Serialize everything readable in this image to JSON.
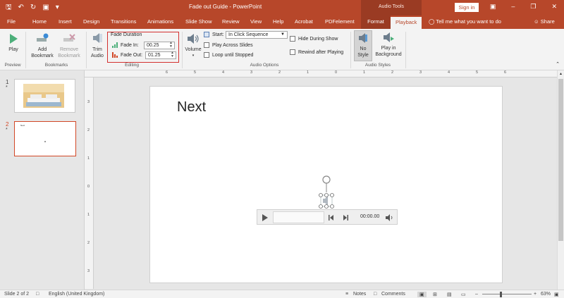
{
  "titlebar": {
    "doc_title": "Fade out Guide  -  PowerPoint",
    "context_group": "Audio Tools",
    "sign_in": "Sign in",
    "qat_icons": [
      "save-icon",
      "undo-icon",
      "redo-icon",
      "presentation-icon",
      "customize-icon"
    ],
    "window_controls": [
      "ribbon-options-icon",
      "minimize-icon",
      "restore-icon",
      "close-icon"
    ]
  },
  "tabs": [
    "File",
    "Home",
    "Insert",
    "Design",
    "Transitions",
    "Animations",
    "Slide Show",
    "Review",
    "View",
    "Help",
    "Acrobat",
    "PDFelement",
    "Format",
    "Playback"
  ],
  "tell_me": "Tell me what you want to do",
  "share": "Share",
  "ribbon": {
    "preview": {
      "label": "Preview",
      "play": "Play"
    },
    "bookmarks": {
      "label": "Bookmarks",
      "add_line1": "Add",
      "add_line2": "Bookmark",
      "remove_line1": "Remove",
      "remove_line2": "Bookmark"
    },
    "editing": {
      "label": "Editing",
      "trim_line1": "Trim",
      "trim_line2": "Audio",
      "fade_duration": "Fade Duration",
      "fade_in_label": "Fade In:",
      "fade_in_value": "00.25",
      "fade_out_label": "Fade Out:",
      "fade_out_value": "01.25"
    },
    "audio_options": {
      "label": "Audio Options",
      "volume": "Volume",
      "start_label": "Start:",
      "start_value": "In Click Sequence",
      "play_across": "Play Across Slides",
      "loop": "Loop until Stopped",
      "hide": "Hide During Show",
      "rewind": "Rewind after Playing"
    },
    "audio_styles": {
      "label": "Audio Styles",
      "no_style_line1": "No",
      "no_style_line2": "Style",
      "bg_line1": "Play in",
      "bg_line2": "Background"
    }
  },
  "slides": [
    {
      "number": "1",
      "star": "*"
    },
    {
      "number": "2",
      "star": "*",
      "thumb_text": "Next"
    }
  ],
  "ruler": {
    "h_ticks": [
      "6",
      "5",
      "4",
      "3",
      "2",
      "1",
      "0",
      "1",
      "2",
      "3",
      "4",
      "5",
      "6"
    ],
    "v_ticks": [
      "3",
      "2",
      "1",
      "0",
      "1",
      "2",
      "3"
    ]
  },
  "slide": {
    "title": "Next",
    "player_time": "00:00.00"
  },
  "status": {
    "slide": "Slide 2 of 2",
    "language": "English (United Kingdom)",
    "notes": "Notes",
    "comments": "Comments",
    "zoom": "63%"
  }
}
